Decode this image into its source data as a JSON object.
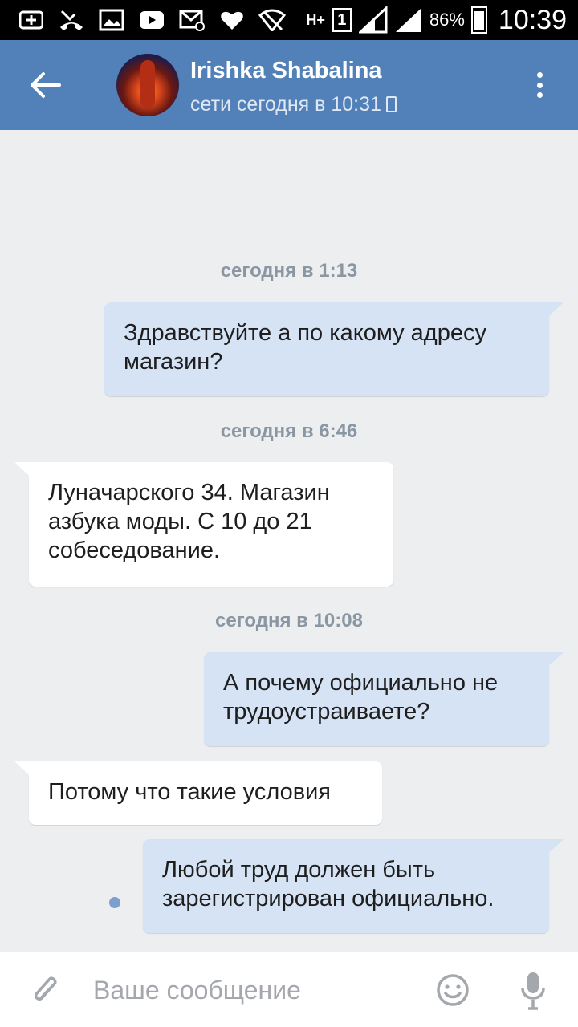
{
  "status_bar": {
    "network": "H+",
    "sim": "1",
    "battery_percent": "86%",
    "time": "10:39"
  },
  "header": {
    "contact_name": "Irishka Shabalina",
    "contact_status": "сети сегодня в 10:31",
    "colors": {
      "header_bg": "#5181b8",
      "bubble_out": "#d5e3f5",
      "bubble_in": "#ffffff",
      "chat_bg": "#edeef0"
    }
  },
  "chat": {
    "dates": [
      "сегодня в 1:13",
      "сегодня в 6:46",
      "сегодня в 10:08"
    ],
    "messages": [
      {
        "direction": "out",
        "lines": [
          "Здравствуйте а по какому адресу",
          "магазин?"
        ]
      },
      {
        "direction": "in",
        "lines": [
          "Луначарского 34. Магазин",
          "азбука моды. С 10 до 21",
          "собеседование."
        ]
      },
      {
        "direction": "out",
        "lines": [
          "А почему официально не",
          "трудоустраиваете?"
        ]
      },
      {
        "direction": "in",
        "lines": [
          "Потому что такие условия"
        ]
      },
      {
        "direction": "out",
        "lines": [
          "Любой труд должен быть",
          "зарегистрирован официально."
        ],
        "unread": true
      }
    ]
  },
  "input": {
    "placeholder": "Ваше сообщение",
    "value": ""
  },
  "icons": [
    "back-arrow-icon",
    "menu-dots-icon",
    "phone-icon",
    "attach-icon",
    "emoji-icon",
    "mic-icon"
  ]
}
